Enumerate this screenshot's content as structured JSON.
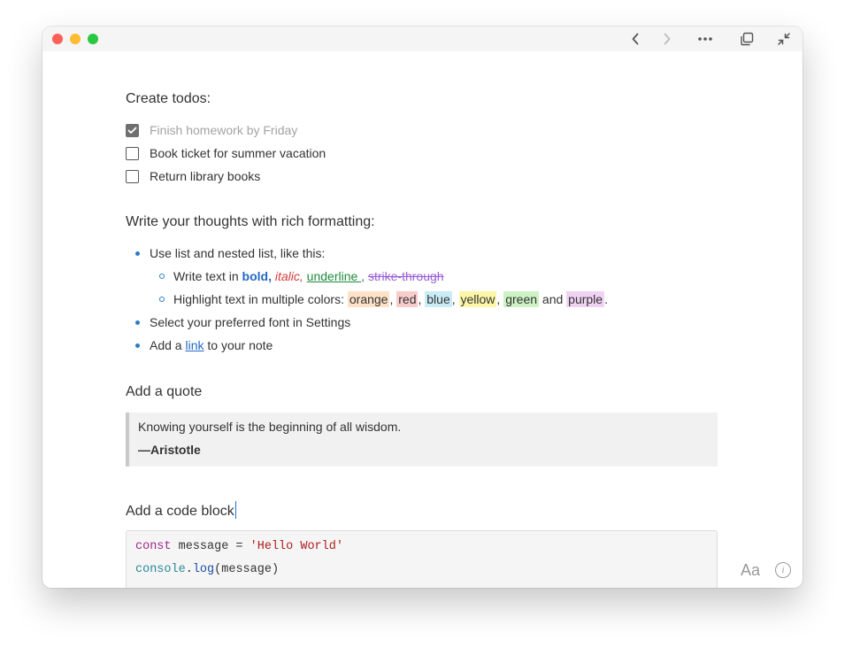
{
  "sections": {
    "todos": {
      "heading": "Create todos:",
      "items": [
        {
          "label": "Finish homework by Friday",
          "checked": true
        },
        {
          "label": "Book ticket for summer vacation",
          "checked": false
        },
        {
          "label": "Return library books",
          "checked": false
        }
      ]
    },
    "rich": {
      "heading": "Write your thoughts with rich formatting:",
      "item1": "Use list and nested list, like this:",
      "nested1": {
        "prefix": "Write text in ",
        "bold": "bold",
        "comma1": ",",
        "italic": "italic",
        "comma2": ",",
        "underline": "underline ",
        "comma3": ",",
        "strike": "strike-through"
      },
      "nested2": {
        "prefix": "Highlight text in multiple colors: ",
        "orange": "orange",
        "red": "red",
        "blue": "blue",
        "yellow": "yellow",
        "green": "green",
        "and": " and ",
        "purple": "purple",
        "sep": ", ",
        "end": "."
      },
      "item2": "Select your preferred font in Settings",
      "item3": {
        "prefix": "Add a ",
        "link": "link",
        "suffix": " to your note"
      }
    },
    "quote": {
      "heading": "Add a quote",
      "text": "Knowing yourself is the beginning of all wisdom.",
      "author": "—Aristotle"
    },
    "code": {
      "heading": "Add a code block",
      "line1": {
        "kw": "const",
        "mid": " message = ",
        "str": "'Hello World'"
      },
      "line2": {
        "obj": "console",
        "dot": ".",
        "fn": "log",
        "rest": "(message)"
      }
    }
  },
  "footer": {
    "font_button": "Aa",
    "info_glyph": "i"
  },
  "colors": {
    "accent": "#2a7cc7",
    "close": "#fe5f57",
    "minimize": "#febc2e",
    "maximize": "#28c840"
  },
  "icons": [
    "back-icon",
    "forward-icon",
    "more-icon",
    "duplicate-icon",
    "shrink-icon",
    "info-icon"
  ]
}
